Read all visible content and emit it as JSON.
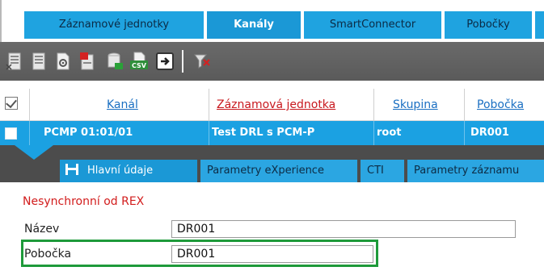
{
  "top_tabs": [
    {
      "label": "Záznamové jednotky",
      "active": false
    },
    {
      "label": "Kanály",
      "active": true
    },
    {
      "label": "SmartConnector",
      "active": false
    },
    {
      "label": "Pobočky",
      "active": false
    }
  ],
  "toolbar": {
    "csv_label": "CSV",
    "icons": [
      "server-icon",
      "server-edit-icon",
      "document-settings-icon",
      "server-delete-icon",
      "storage-green-icon",
      "csv-export-icon",
      "exit-icon",
      "filter-clear-icon"
    ]
  },
  "grid": {
    "columns": [
      "Kanál",
      "Záznamová jednotka",
      "Skupina",
      "Pobočka"
    ],
    "selected_row": {
      "kanal": "PCMP 01:01/01",
      "zaznamova_jednotka": "Test DRL s PCM-P",
      "skupina": "root",
      "pobocka": "DR001"
    }
  },
  "detail_tabs": [
    {
      "label": "Hlavní údaje",
      "active": true
    },
    {
      "label": "Parametry eXperience",
      "active": false
    },
    {
      "label": "CTI",
      "active": false
    },
    {
      "label": "Parametry záznamu",
      "active": false
    }
  ],
  "form": {
    "section_title": "Nesynchronní od REX",
    "fields": [
      {
        "label": "Název",
        "value": "DR001"
      },
      {
        "label": "Pobočka",
        "value": "DR001"
      }
    ]
  },
  "colors": {
    "tab_blue": "#1fa3e0",
    "selected_row": "#1ba1e2",
    "toolbar_gray": "#5f5f5f",
    "highlight_green": "#1e9a3a",
    "header_red": "#c8181e"
  }
}
